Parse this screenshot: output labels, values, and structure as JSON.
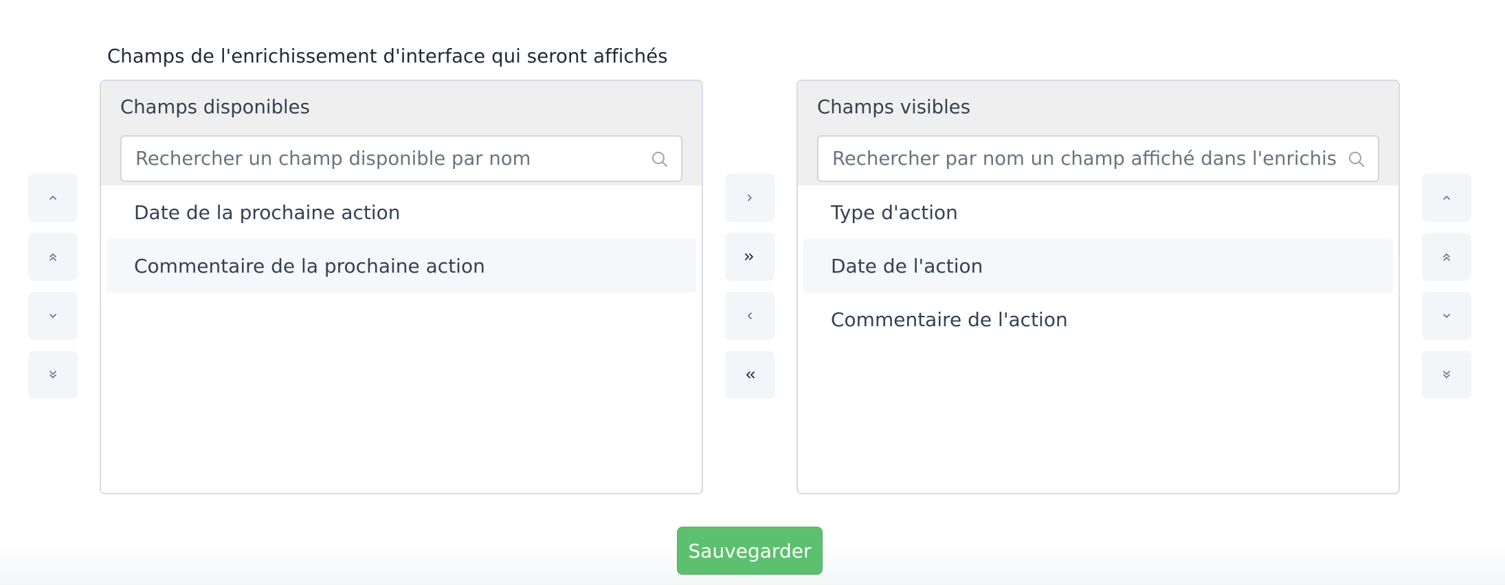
{
  "section": {
    "label": "Champs de l'enrichissement d'interface qui seront affichés"
  },
  "available": {
    "title": "Champs disponibles",
    "search_placeholder": "Rechercher un champ disponible par nom",
    "search_value": "",
    "items": [
      "Date de la prochaine action",
      "Commentaire de la prochaine action"
    ]
  },
  "visible": {
    "title": "Champs visibles",
    "search_placeholder": "Rechercher par nom un champ affiché dans l'enrichissement d'interface",
    "search_value": "",
    "items": [
      "Type d'action",
      "Date de l'action",
      "Commentaire de l'action"
    ]
  },
  "controls": {
    "left": [
      "chevron-up-icon",
      "chevrons-up-icon",
      "chevron-down-icon",
      "chevrons-down-icon"
    ],
    "middle": [
      "chevron-right-icon",
      "chevrons-right-icon",
      "chevron-left-icon",
      "chevrons-left-icon"
    ],
    "right": [
      "chevron-up-icon",
      "chevrons-up-icon",
      "chevron-down-icon",
      "chevrons-down-icon"
    ]
  },
  "actions": {
    "save_label": "Sauvegarder"
  },
  "colors": {
    "save_button": "#5cc06e",
    "panel_header": "#efefef",
    "panel_border": "#d6dae6",
    "control_button": "#f3f5f8"
  }
}
